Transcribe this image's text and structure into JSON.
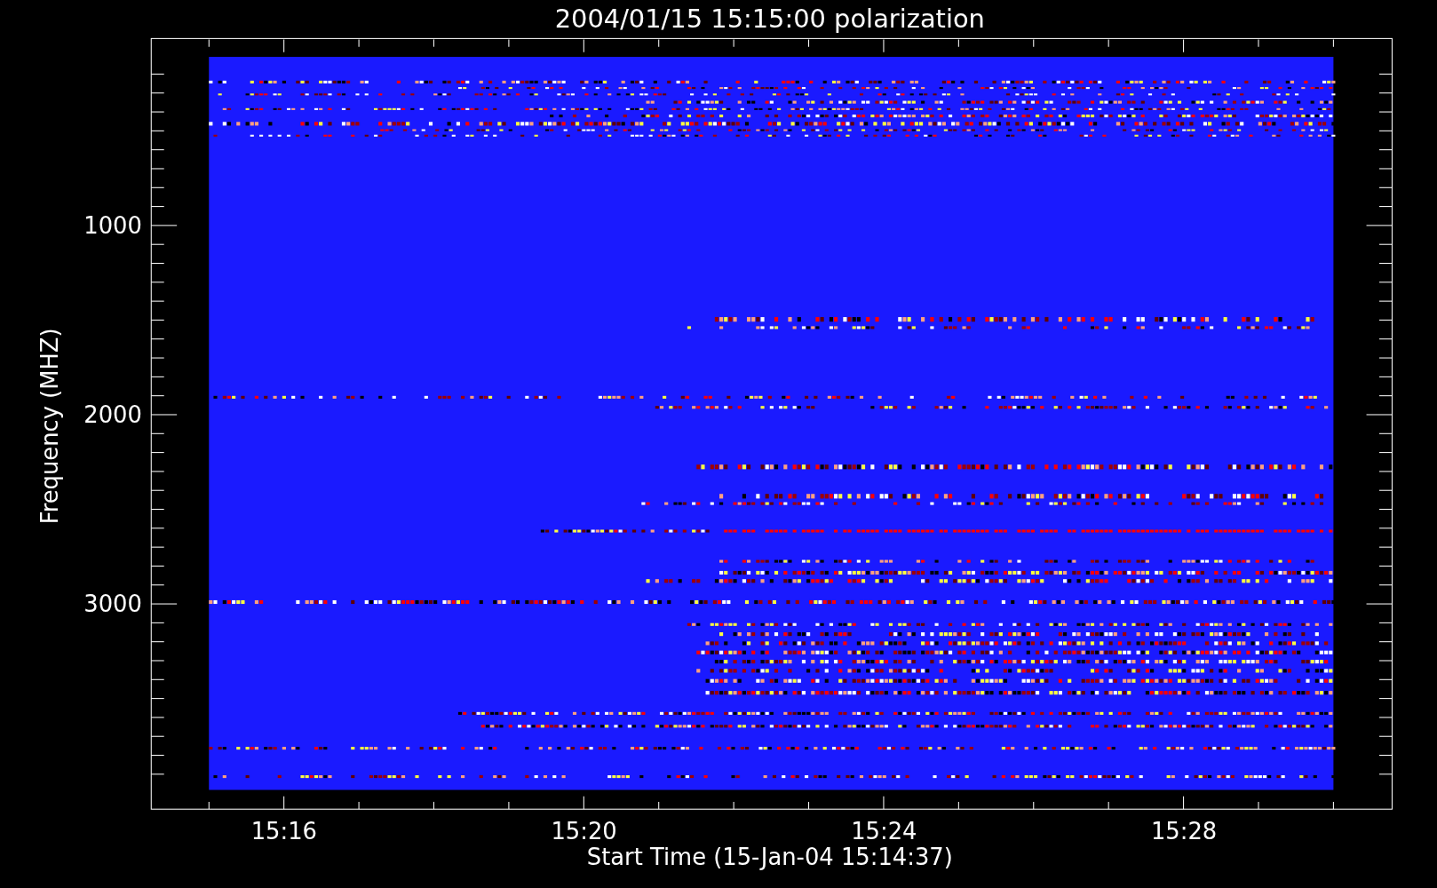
{
  "plot": {
    "title": "2004/01/15 15:15:00 polarization",
    "xlabel": "Start Time (15-Jan-04 15:14:37)",
    "ylabel": "Frequency (MHZ)",
    "x_tick_labels": [
      "15:16",
      "15:20",
      "15:24",
      "15:28"
    ],
    "y_tick_labels": [
      "1000",
      "2000",
      "3000"
    ]
  }
}
